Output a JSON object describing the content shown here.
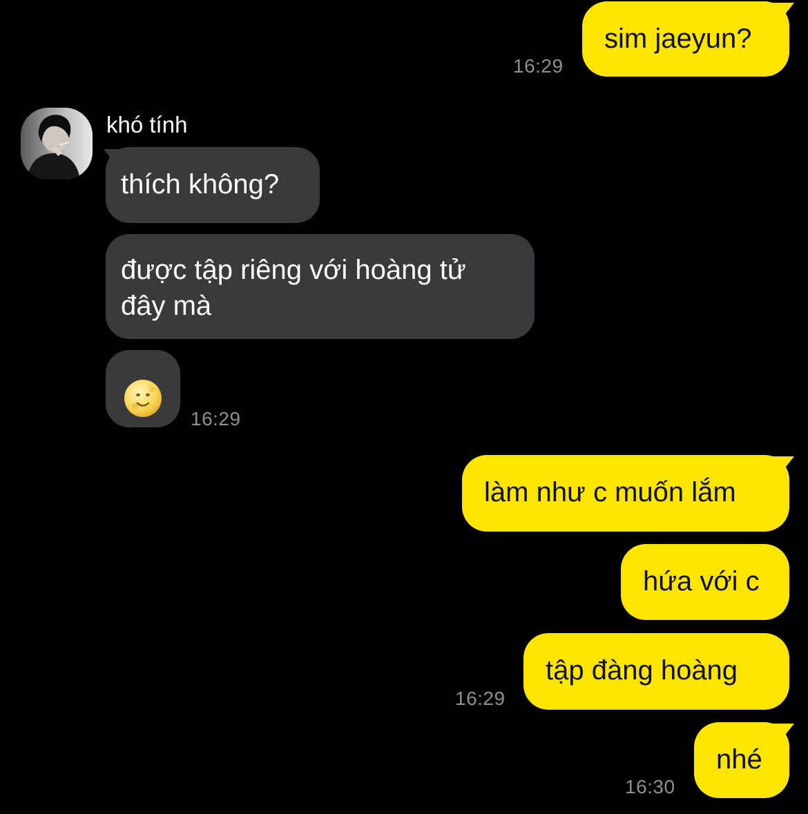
{
  "conversation": {
    "contact": {
      "name": "khó tính",
      "avatar_icon": "profile-photo-avatar"
    },
    "colors": {
      "outgoing_bubble": "#fee500",
      "incoming_bubble": "#3a3a3c",
      "background": "#000000",
      "timestamp": "#8e8e93"
    },
    "messages": [
      {
        "direction": "outgoing",
        "text": "sim jaeyun?",
        "time": "16:29"
      },
      {
        "direction": "incoming",
        "text": "thích không?"
      },
      {
        "direction": "incoming",
        "text": "được tập riêng với hoàng tử\nđây mà"
      },
      {
        "direction": "incoming",
        "text": "🌝",
        "time": "16:29"
      },
      {
        "direction": "outgoing",
        "text": "làm như c muốn lắm"
      },
      {
        "direction": "outgoing",
        "text": "hứa với c"
      },
      {
        "direction": "outgoing",
        "text": "tập đàng hoàng",
        "time": "16:29"
      },
      {
        "direction": "outgoing",
        "text": "nhé",
        "time": "16:30"
      }
    ]
  }
}
